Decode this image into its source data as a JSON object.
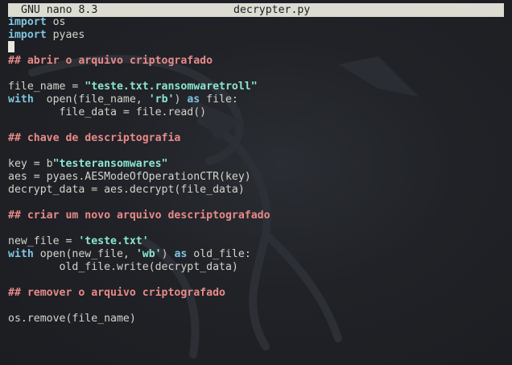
{
  "titlebar": {
    "app": "GNU nano 8.3",
    "filename": "decrypter.py"
  },
  "colors": {
    "keyword": "#7fc4e0",
    "comment": "#e88a8a",
    "string": "#8ce6d2",
    "text": "#d4d4cc",
    "background": "#1f2126",
    "titlebar": "#dcdcd2"
  },
  "code": {
    "l1": {
      "kw": "import",
      "rest": " os"
    },
    "l2": {
      "kw": "import",
      "rest": " pyaes"
    },
    "l4": {
      "comment": "## abrir o arquivo criptografado"
    },
    "l6": {
      "pre": "file_name = ",
      "str": "\"teste.txt.ransomwaretroll\""
    },
    "l7": {
      "kw": "with",
      "pre": "  open(file_name, ",
      "str": "'rb'",
      "mid": ") ",
      "kw2": "as",
      "post": " file:"
    },
    "l8": {
      "text": "        file_data = file.read()"
    },
    "l10": {
      "comment": "## chave de descriptografia"
    },
    "l12": {
      "pre": "key = b",
      "str": "\"testeransomwares\""
    },
    "l13": {
      "text": "aes = pyaes.AESModeOfOperationCTR(key)"
    },
    "l14": {
      "text": "decrypt_data = aes.decrypt(file_data)"
    },
    "l16": {
      "comment": "## criar um novo arquivo descriptografado"
    },
    "l18": {
      "pre": "new_file = ",
      "str": "'teste.txt'"
    },
    "l19": {
      "kw": "with",
      "pre": " open(new_file, ",
      "str": "'wb'",
      "mid": ") ",
      "kw2": "as",
      "post": " old_file:"
    },
    "l20": {
      "text": "        old_file.write(decrypt_data)"
    },
    "l22": {
      "comment": "## remover o arquivo criptografado"
    },
    "l24": {
      "text": "os.remove(file_name)"
    }
  }
}
